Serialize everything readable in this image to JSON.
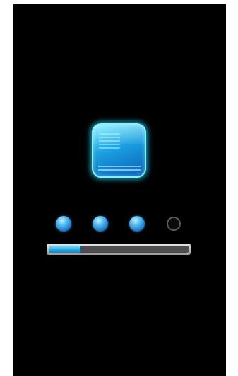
{
  "loading": {
    "icon": "terminal-app-icon",
    "accent_color": "#1fa6e0",
    "steps_total": 4,
    "steps_completed": 3,
    "progress_fraction": 0.22
  }
}
